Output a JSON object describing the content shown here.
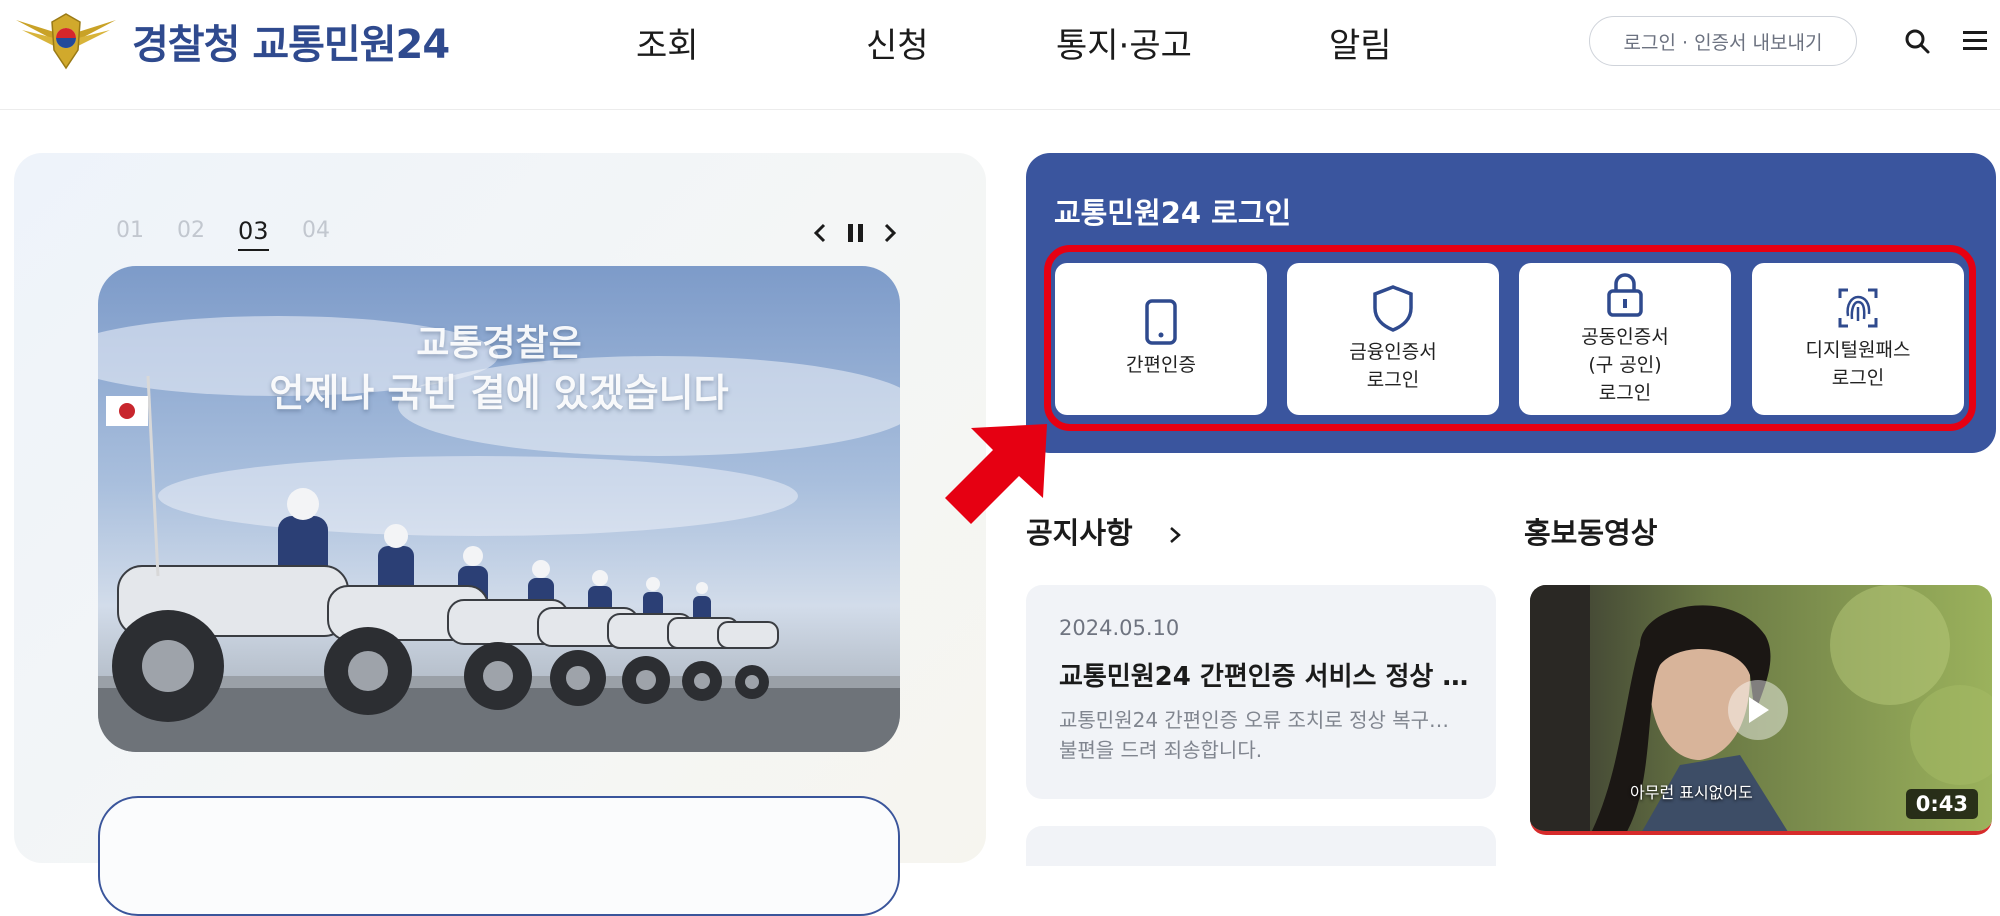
{
  "header": {
    "logo_text": "경찰청 교통민원24",
    "nav": [
      "조회",
      "신청",
      "통지·공고",
      "알림"
    ],
    "util_button": "로그인 · 인증서 내보내기",
    "search_icon": "search-icon",
    "menu_icon": "hamburger-menu-icon"
  },
  "slider": {
    "numbers": [
      "01",
      "02",
      "03",
      "04"
    ],
    "active": "03",
    "banner_line1": "교통경찰은",
    "banner_line2": "언제나 국민 곁에 있겠습니다"
  },
  "login": {
    "title": "교통민원24 로그인",
    "options": [
      {
        "label": "간편인증",
        "icon": "smartphone-icon"
      },
      {
        "label": "금융인증서\n로그인",
        "icon": "shield-icon"
      },
      {
        "label": "공동인증서\n(구 공인)\n로그인",
        "icon": "lock-icon"
      },
      {
        "label": "디지털원패스\n로그인",
        "icon": "fingerprint-icon"
      }
    ]
  },
  "notice": {
    "title": "공지사항",
    "date": "2024.05.10",
    "item_title": "교통민원24 간편인증 서비스 정상 …",
    "body_line1": "교통민원24 간편인증 오류 조치로 정상 복구…",
    "body_line2": "불편을 드려 죄송합니다."
  },
  "video": {
    "title": "홍보동영상",
    "duration": "0:43",
    "caption": "아무런 표시없어도"
  },
  "colors": {
    "brand_blue": "#3a559e",
    "highlight_red": "#e60012"
  }
}
